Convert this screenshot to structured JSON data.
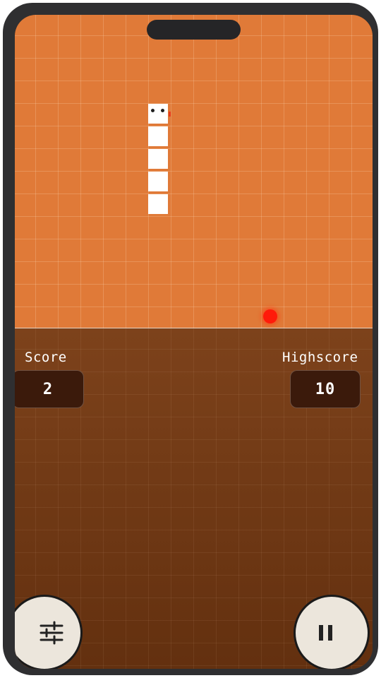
{
  "game": {
    "score_label": "Score",
    "score_value": "2",
    "highscore_label": "Highscore",
    "highscore_value": "10"
  },
  "controls": {
    "settings_icon": "sliders-icon",
    "pause_icon": "pause-icon"
  },
  "colors": {
    "board": "#e07a38",
    "lower_panel": "#7a3f19",
    "snake": "#ffffff",
    "food": "#ff1a0a",
    "stat_box": "#3b1a0b",
    "button": "#ece6dc"
  }
}
